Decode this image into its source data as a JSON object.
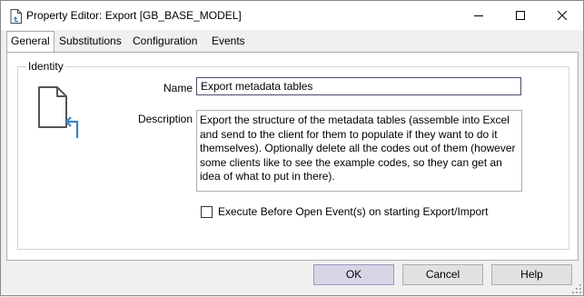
{
  "window": {
    "title": "Property Editor: Export [GB_BASE_MODEL]"
  },
  "tabs": [
    {
      "label": "General",
      "active": true
    },
    {
      "label": "Substitutions",
      "active": false
    },
    {
      "label": "Configuration",
      "active": false
    },
    {
      "label": "Events",
      "active": false
    }
  ],
  "identity": {
    "group_title": "Identity",
    "icon": "document-export-icon",
    "name_label": "Name",
    "name_value": "Export metadata tables",
    "description_label": "Description",
    "description_value": "Export the structure of the metadata tables (assemble into Excel and send to the client for them to populate if they want to do it themselves). Optionally delete all the codes out of them (however some clients like to see the example codes, so they can get an idea of what to put in there).",
    "execute_checkbox_label": "Execute Before Open Event(s) on starting Export/Import",
    "execute_checked": false
  },
  "buttons": {
    "ok": "OK",
    "cancel": "Cancel",
    "help": "Help"
  },
  "colors": {
    "accent": "#3b82c4",
    "default_button": "#d8d6e6"
  }
}
